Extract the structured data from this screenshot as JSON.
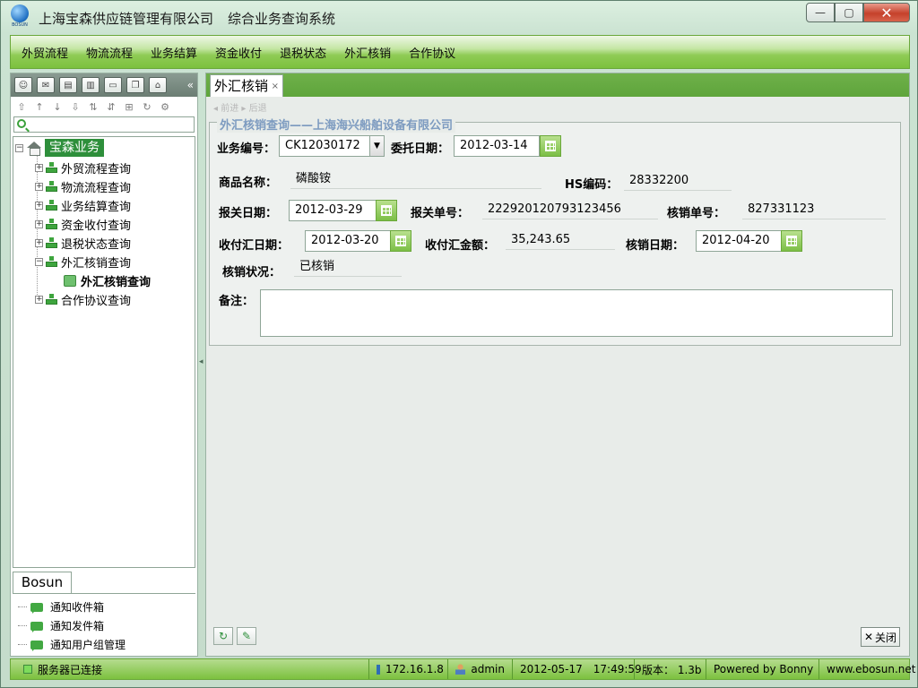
{
  "window": {
    "company": "上海宝森供应链管理有限公司",
    "system": "综合业务查询系统",
    "logo_text": "BOSUN",
    "min_label": "—",
    "max_label": "▢",
    "close_label": "✕"
  },
  "menu": [
    "外贸流程",
    "物流流程",
    "业务结算",
    "资金收付",
    "退税状态",
    "外汇核销",
    "合作协议"
  ],
  "sidebar": {
    "collapse_label": "«",
    "root_label": "宝森业务",
    "items": [
      {
        "label": "外贸流程查询"
      },
      {
        "label": "物流流程查询"
      },
      {
        "label": "业务结算查询"
      },
      {
        "label": "资金收付查询"
      },
      {
        "label": "退税状态查询"
      },
      {
        "label": "外汇核销查询",
        "expanded": true
      }
    ],
    "child_label": "外汇核销查询",
    "last_item": "合作协议查询",
    "bottom_tab": "Bosun",
    "notices": [
      "通知收件箱",
      "通知发件箱",
      "通知用户组管理"
    ]
  },
  "tab": {
    "label": "外汇核销",
    "close": "×",
    "subnav": "◂ 前进   ▸ 后退"
  },
  "form": {
    "legend": "外汇核销查询——上海海兴船舶设备有限公司",
    "business_no_label": "业务编号：",
    "business_no": "CK12030172",
    "entrust_date_label": "委托日期：",
    "entrust_date": "2012-03-14",
    "product_label": "商品名称：",
    "product": "磷酸铵",
    "hs_label": "HS编码：",
    "hs": "28332200",
    "customs_date_label": "报关日期：",
    "customs_date": "2012-03-29",
    "customs_no_label": "报关单号：",
    "customs_no": "222920120793123456",
    "verify_no_label": "核销单号：",
    "verify_no": "827331123",
    "receipt_date_label": "收付汇日期：",
    "receipt_date": "2012-03-20",
    "receipt_amount_label": "收付汇金额：",
    "receipt_amount": "35,243.65",
    "verify_date_label": "核销日期：",
    "verify_date": "2012-04-20",
    "verify_status_label": "核销状况：",
    "verify_status": "已核销",
    "remark_label": "备注："
  },
  "actions": {
    "close_label": "关闭",
    "close_x": "✕"
  },
  "status": {
    "server": "服务器已连接",
    "ip": "172.16.1.8",
    "user": "admin",
    "date": "2012-05-17",
    "time": "17:49:59",
    "version": "版本： 1.3b",
    "powered": "Powered by Bonny",
    "site": "www.ebosun.net"
  },
  "colors": {
    "menu_green": "#7cc13e",
    "tree_selected": "#2e8f3b",
    "legend_blue": "#7d9bc0"
  }
}
